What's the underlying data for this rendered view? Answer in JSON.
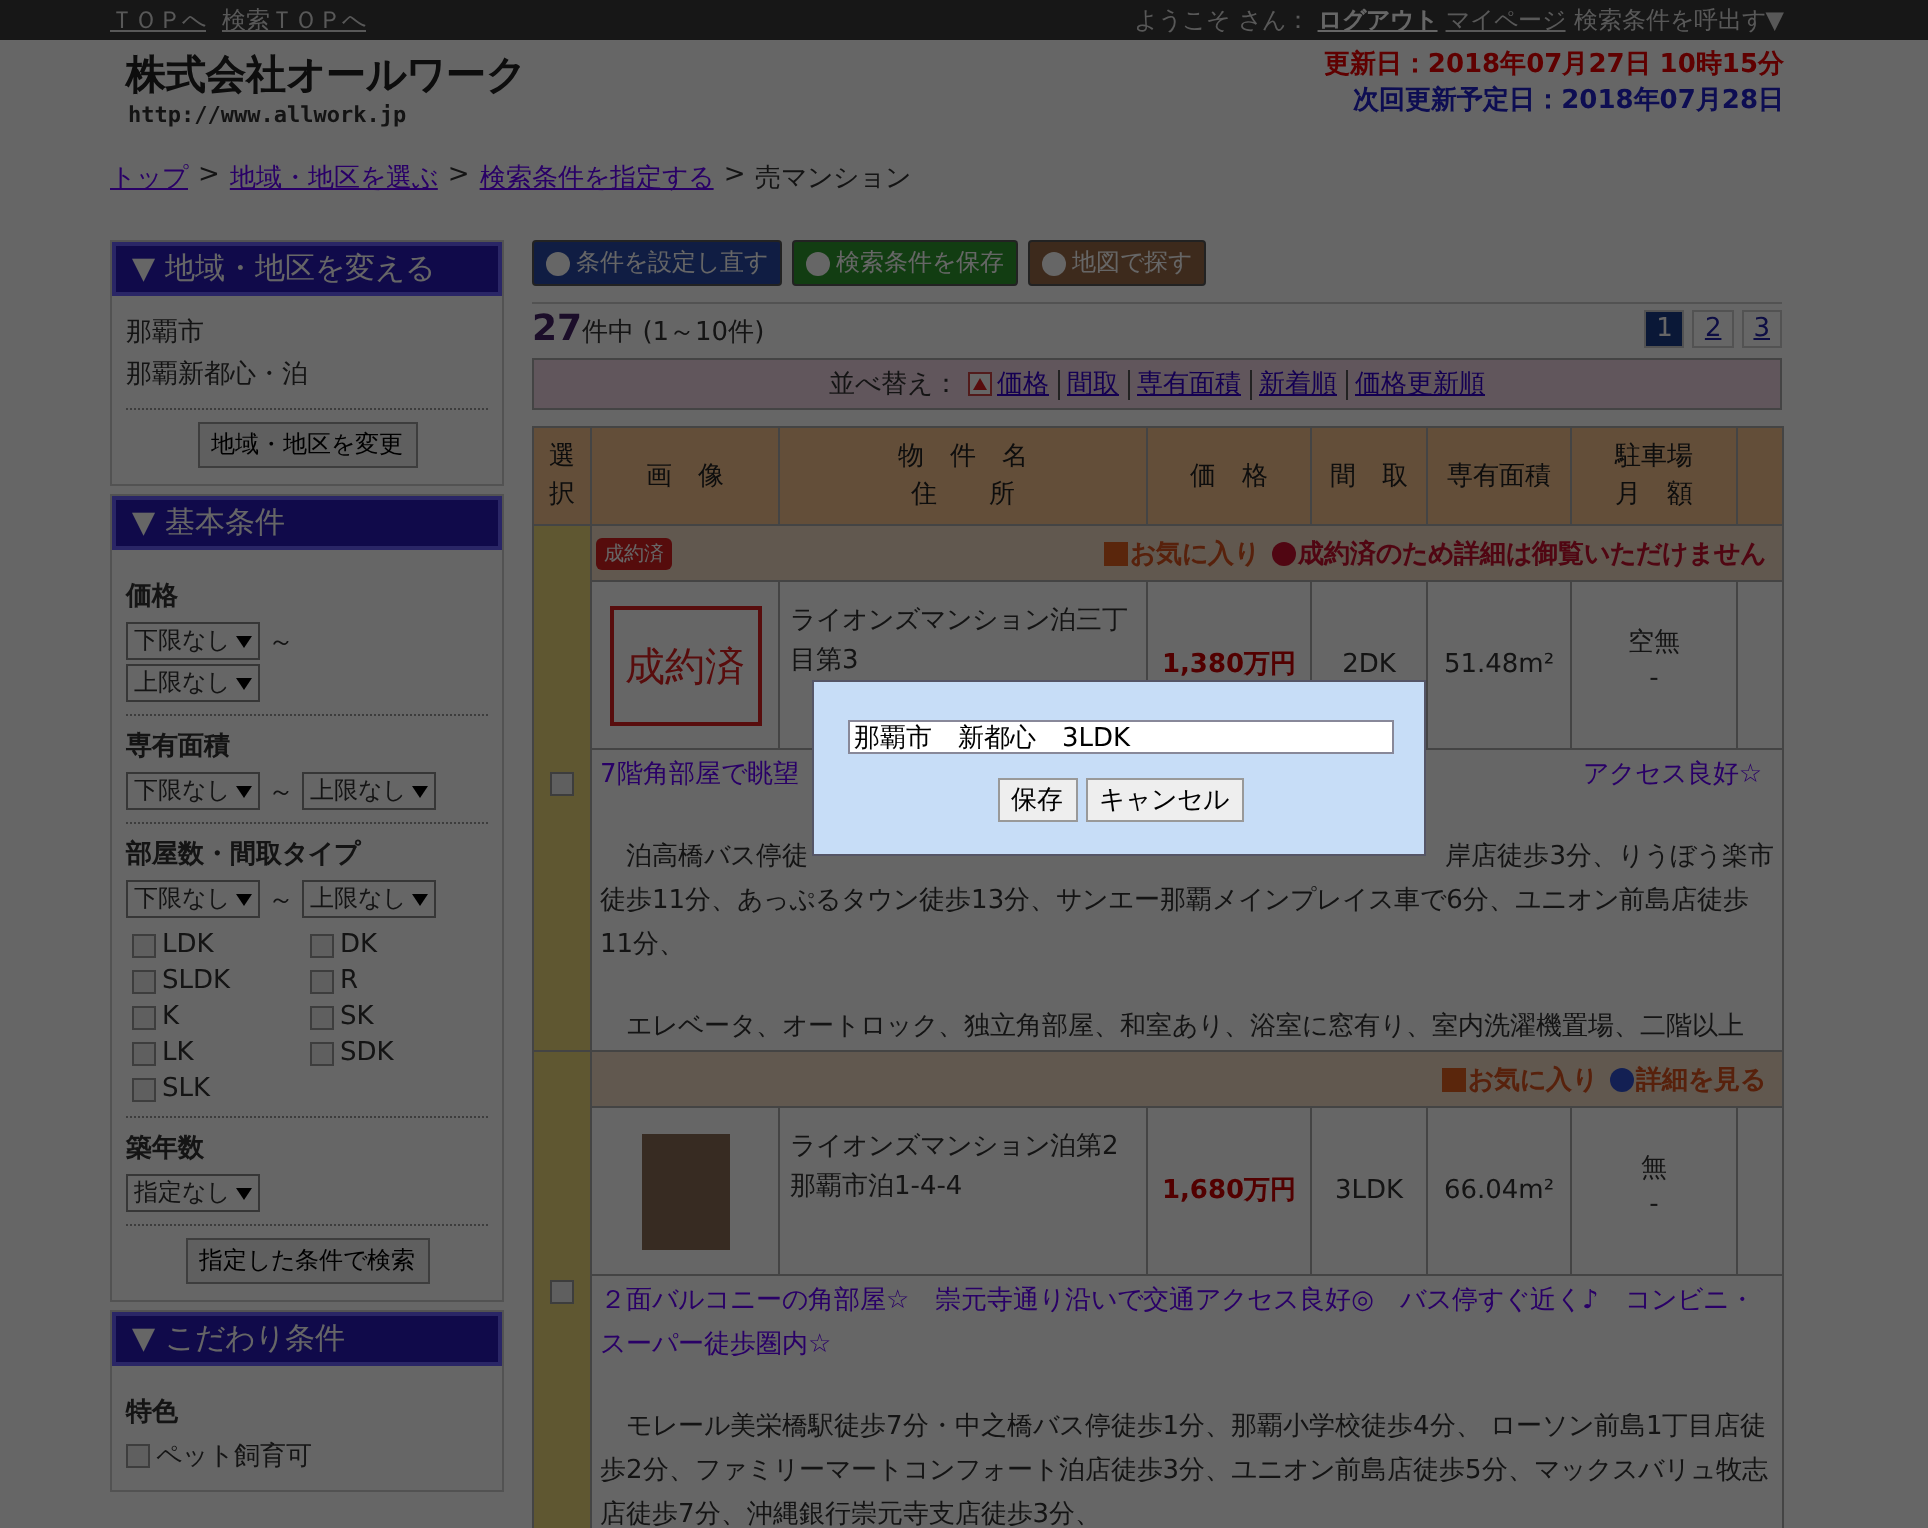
{
  "top_bar": {
    "links": [
      "ＴＯＰへ",
      "検索ＴＯＰへ"
    ],
    "welcome": "ようこそ",
    "suffix": "さん：",
    "user_links": [
      "ログアウト",
      "マイページ"
    ],
    "recall": "検索条件を呼出す▼"
  },
  "header": {
    "company": "株式会社オールワーク",
    "url": "http://www.allwork.jp",
    "updated": "更新日：2018年07月27日 10時15分",
    "next_update": "次回更新予定日：2018年07月28日"
  },
  "breadcrumb": {
    "links": [
      "トップ",
      "地域・地区を選ぶ",
      "検索条件を指定する"
    ],
    "separator": ">",
    "current": "売マンション"
  },
  "sidebar": {
    "area": {
      "title": "▼ 地域・地区を変える",
      "lines": [
        "那覇市",
        "那覇新都心・泊"
      ],
      "button": "地域・地区を変更"
    },
    "basic": {
      "title": "▼ 基本条件",
      "groups": [
        {
          "kind": "range_stacked",
          "label": "価格",
          "from": "下限なし",
          "to": "上限なし",
          "tilde": "～"
        },
        {
          "kind": "range",
          "label": "専有面積",
          "from": "下限なし",
          "to": "上限なし",
          "tilde": "～"
        },
        {
          "kind": "range_checks",
          "label": "部屋数・間取タイプ",
          "from": "下限なし",
          "to": "上限なし",
          "tilde": "～",
          "checks": [
            {
              "label": "LDK",
              "checked": false
            },
            {
              "label": "DK",
              "checked": false
            },
            {
              "label": "SLDK",
              "checked": false
            },
            {
              "label": "R",
              "checked": false
            },
            {
              "label": "K",
              "checked": false
            },
            {
              "label": "SK",
              "checked": false
            },
            {
              "label": "LK",
              "checked": false
            },
            {
              "label": "SDK",
              "checked": false
            },
            {
              "label": "SLK",
              "checked": false
            }
          ]
        },
        {
          "kind": "single",
          "label": "築年数",
          "value": "指定なし"
        }
      ],
      "button": "指定した条件で検索"
    },
    "special": {
      "title": "▼ こだわり条件",
      "label": "特色",
      "checks": [
        {
          "label": "ペット飼育可",
          "checked": false
        }
      ]
    }
  },
  "toolbar": [
    {
      "label": "条件を設定し直す",
      "kind": "reset"
    },
    {
      "label": "検索条件を保存",
      "kind": "save"
    },
    {
      "label": "地図で探す",
      "kind": "map"
    }
  ],
  "results": {
    "count": "27",
    "range": "件中 (1～10件)",
    "pages": [
      {
        "label": "1",
        "selected": true
      },
      {
        "label": "2",
        "selected": false
      },
      {
        "label": "3",
        "selected": false
      }
    ]
  },
  "sort": {
    "label": "並べ替え：",
    "options": [
      {
        "label": "価格",
        "sorted": true
      },
      {
        "label": "間取",
        "sorted": false
      },
      {
        "label": "専有面積",
        "sorted": false
      },
      {
        "label": "新着順",
        "sorted": false
      },
      {
        "label": "価格更新順",
        "sorted": false
      }
    ]
  },
  "table": {
    "columns": [
      [
        "選",
        "択"
      ],
      [
        "画　像"
      ],
      [
        "物　件　名",
        "住　　所"
      ],
      [
        "価　格"
      ],
      [
        "間　取"
      ],
      [
        "専有面積"
      ],
      [
        "駐車場",
        "月　額"
      ]
    ],
    "rows": [
      {
        "badge": "成約済",
        "actions": [
          {
            "kind": "favorite",
            "label": "お気に入り"
          },
          {
            "kind": "closed",
            "label": "成約済のため詳細は御覧いただけません"
          }
        ],
        "image": {
          "kind": "stamp",
          "text": "成約済"
        },
        "name": "ライオンズマンション泊三丁目第3",
        "price": "1,380万円",
        "layout": "2DK",
        "area": "51.48m²",
        "parking": [
          "空無",
          "-"
        ],
        "checked": false,
        "title": [
          "7階角部屋で眺望",
          "アクセス良好☆"
        ],
        "description": [
          [
            [
              "泊高橋バス停徒",
              "岸店徒歩3分、りうぼう楽市"
            ],
            [
              "徒歩11分、あっぷるタウン徒歩13分、サンエー那覇メインプレイス車で6分、ユニオン前島店徒歩11分、"
            ]
          ],
          [
            [
              "エレベータ、オートロック、独立角部屋、和室あり、浴室に窓有り、室内洗濯機置場、二階以上"
            ]
          ]
        ]
      },
      {
        "actions": [
          {
            "kind": "favorite",
            "label": "お気に入り"
          },
          {
            "kind": "detail",
            "label": "詳細を見る"
          }
        ],
        "image": {
          "kind": "photo"
        },
        "name": "ライオンズマンション泊第2",
        "address": "那覇市泊1-4-4",
        "price": "1,680万円",
        "layout": "3LDK",
        "area": "66.04m²",
        "parking": [
          "無",
          "-"
        ],
        "checked": false,
        "title": [
          "２面バルコニーの角部屋☆　崇元寺通り沿いで交通アクセス良好◎　バス停すぐ近く♪　コンビニ・スーパー徒歩圏内☆"
        ],
        "description": [
          [
            [
              "モレール美栄橋駅徒歩7分・中之橋バス停徒歩1分、那覇小学校徒歩4分、 ローソン前島1丁目店徒歩2分、ファミリーマートコンフォート泊店徒歩3分、ユニオン前島店徒歩5分、マックスバリュ牧志店徒歩7分、沖縄銀行崇元寺支店徒歩3分、"
            ]
          ]
        ]
      }
    ]
  },
  "dialog": {
    "value": "那覇市　新都心　3LDK",
    "buttons": [
      "保存",
      "キャンセル"
    ]
  }
}
